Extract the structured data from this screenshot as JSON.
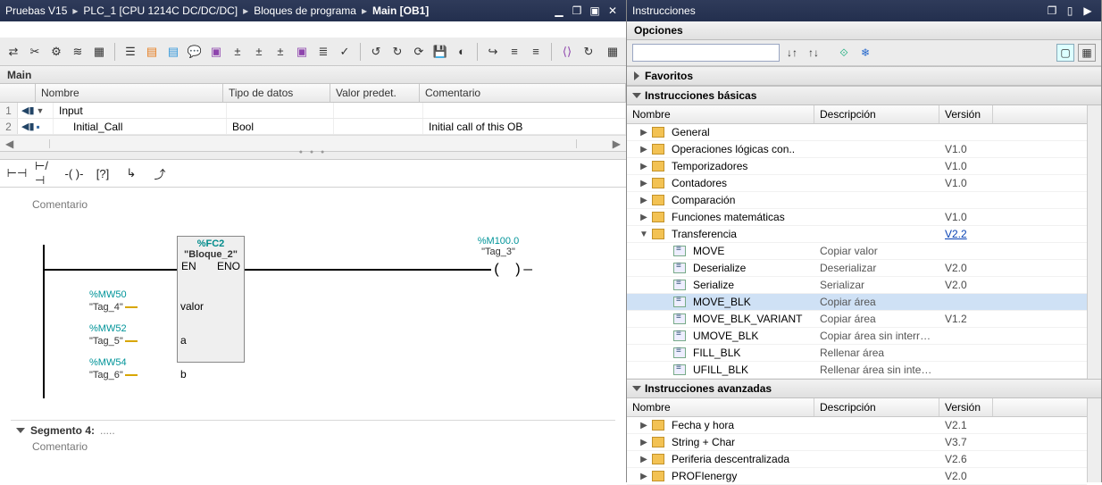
{
  "breadcrumb": [
    "Pruebas V15",
    "PLC_1 [CPU 1214C DC/DC/DC]",
    "Bloques de programa",
    "Main [OB1]"
  ],
  "main_title": "Main",
  "iface": {
    "cols": {
      "name": "Nombre",
      "type": "Tipo de datos",
      "def": "Valor predet.",
      "com": "Comentario"
    },
    "rows": [
      {
        "num": "1",
        "name": "Input",
        "type": "",
        "def": "",
        "com": ""
      },
      {
        "num": "2",
        "name": "Initial_Call",
        "type": "Bool",
        "def": "",
        "com": "Initial call of this OB"
      }
    ]
  },
  "segment_comment": "Comentario",
  "network": {
    "fb_addr": "%FC2",
    "fb_name": "\"Bloque_2\"",
    "en": "EN",
    "eno": "ENO",
    "params": [
      {
        "addr": "%MW50",
        "tag": "\"Tag_4\"",
        "port": "valor"
      },
      {
        "addr": "%MW52",
        "tag": "\"Tag_5\"",
        "port": "a"
      },
      {
        "addr": "%MW54",
        "tag": "\"Tag_6\"",
        "port": "b"
      }
    ],
    "out_addr": "%M100.0",
    "out_tag": "\"Tag_3\""
  },
  "segment4": "Segmento 4:",
  "segment4_comment": "Comentario",
  "instr_title": "Instrucciones",
  "options": "Opciones",
  "search_placeholder": "",
  "favoritos": "Favoritos",
  "basicas": "Instrucciones básicas",
  "tree_cols": {
    "name": "Nombre",
    "desc": "Descripción",
    "ver": "Versión"
  },
  "tree": [
    {
      "exp": "▶",
      "kind": "folder",
      "name": "General",
      "desc": "",
      "ver": ""
    },
    {
      "exp": "▶",
      "kind": "folder",
      "name": "Operaciones lógicas con..",
      "desc": "",
      "ver": "V1.0"
    },
    {
      "exp": "▶",
      "kind": "folder",
      "name": "Temporizadores",
      "desc": "",
      "ver": "V1.0"
    },
    {
      "exp": "▶",
      "kind": "folder",
      "name": "Contadores",
      "desc": "",
      "ver": "V1.0"
    },
    {
      "exp": "▶",
      "kind": "folder",
      "name": "Comparación",
      "desc": "",
      "ver": ""
    },
    {
      "exp": "▶",
      "kind": "folder",
      "name": "Funciones matemáticas",
      "desc": "",
      "ver": "V1.0"
    },
    {
      "exp": "▼",
      "kind": "folder",
      "name": "Transferencia",
      "desc": "",
      "ver": "V2.2",
      "verlink": true
    },
    {
      "exp": "",
      "kind": "inst",
      "indent": 28,
      "name": "MOVE",
      "desc": "Copiar valor",
      "ver": ""
    },
    {
      "exp": "",
      "kind": "inst",
      "indent": 28,
      "name": "Deserialize",
      "desc": "Deserializar",
      "ver": "V2.0"
    },
    {
      "exp": "",
      "kind": "inst",
      "indent": 28,
      "name": "Serialize",
      "desc": "Serializar",
      "ver": "V2.0"
    },
    {
      "exp": "",
      "kind": "inst",
      "indent": 28,
      "name": "MOVE_BLK",
      "desc": "Copiar área",
      "ver": "",
      "sel": true
    },
    {
      "exp": "",
      "kind": "inst",
      "indent": 28,
      "name": "MOVE_BLK_VARIANT",
      "desc": "Copiar área",
      "ver": "V1.2"
    },
    {
      "exp": "",
      "kind": "inst",
      "indent": 28,
      "name": "UMOVE_BLK",
      "desc": "Copiar área sin interrup..",
      "ver": ""
    },
    {
      "exp": "",
      "kind": "inst",
      "indent": 28,
      "name": "FILL_BLK",
      "desc": "Rellenar área",
      "ver": ""
    },
    {
      "exp": "",
      "kind": "inst",
      "indent": 28,
      "name": "UFILL_BLK",
      "desc": "Rellenar área sin interru..",
      "ver": ""
    }
  ],
  "avanzadas": "Instrucciones avanzadas",
  "adv_cols": {
    "name": "Nombre",
    "desc": "Descripción",
    "ver": "Versión"
  },
  "adv": [
    {
      "exp": "▶",
      "kind": "folder",
      "name": "Fecha y hora",
      "desc": "",
      "ver": "V2.1"
    },
    {
      "exp": "▶",
      "kind": "folder",
      "name": "String + Char",
      "desc": "",
      "ver": "V3.7"
    },
    {
      "exp": "▶",
      "kind": "folder",
      "name": "Periferia descentralizada",
      "desc": "",
      "ver": "V2.6"
    },
    {
      "exp": "▶",
      "kind": "folder",
      "name": "PROFIenergy",
      "desc": "",
      "ver": "V2.0"
    }
  ]
}
